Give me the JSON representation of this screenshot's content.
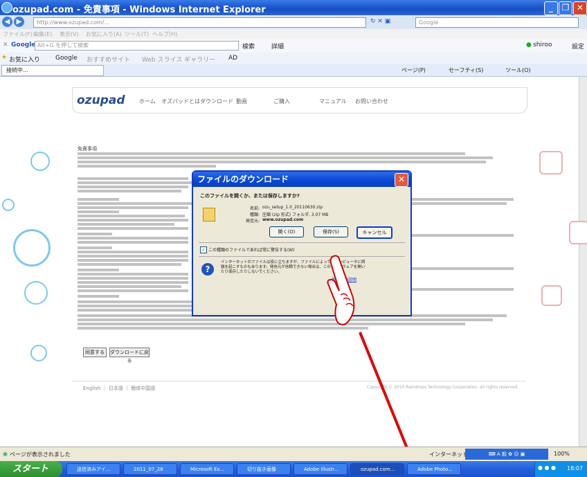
{
  "window": {
    "title": "ozupad.com - 免責事項 - Windows Internet Explorer"
  },
  "addressbar": {
    "url": "http://www.ozupad.com/...",
    "search_placeholder": "Google"
  },
  "menubar": {
    "items": [
      "ファイル(F)",
      "編集(E)",
      "表示(V)",
      "お気に入り(A)",
      "ツール(T)",
      "ヘルプ(H)"
    ]
  },
  "google_toolbar": {
    "label": "Google",
    "search_hint": "Alt+G を押して検索",
    "search_btn": "検索",
    "more": "詳細",
    "user": "shiroo",
    "settings": "設定"
  },
  "favorites": {
    "fav_label": "お気に入り",
    "item1": "Google",
    "item2": "おすすめサイト",
    "item3": "Web スライス ギャラリー",
    "item4": "AD"
  },
  "tab": {
    "label": "接続中..."
  },
  "commandbar": {
    "page": "ページ(P)",
    "safety": "セーフティ(S)",
    "tools": "ツール(O)"
  },
  "site": {
    "logo": "ozupad",
    "nav": [
      "ホーム",
      "オズパッドとは",
      "ダウンロード",
      "動画",
      "ご購入",
      "マニュアル",
      "お問い合わせ"
    ],
    "disclaimer_title": "免責事項",
    "btn_agree": "同意する",
    "btn_back": "ダウンロードに戻る",
    "footer_links": "English ｜ 日本語 ｜ 簡体中国語",
    "copyright": "Copyright © 2010 Raindrops Technology Corporation. all rights reserved."
  },
  "dialog": {
    "title": "ファイルのダウンロード",
    "question": "このファイルを開くか、または保存しますか?",
    "name_label": "名前:",
    "name_value": "ozu_setup_1.0_20110630.zip",
    "type_label": "種類:",
    "type_value": "圧縮 (zip 形式) フォルダ, 3.07 MB",
    "from_label": "発信元:",
    "from_value": "www.ozupad.com",
    "open_btn": "開く(O)",
    "save_btn": "保存(S)",
    "cancel_btn": "キャンセル",
    "checkbox_label": "この種類のファイルであれば常に警告する(W)",
    "warning_text": "インターネットのファイルは役に立ちますが、ファイルによってはコンピュータに問題を起こすものもあります。発信元が信頼できない場合は、このソフトウェアを開いたり保存したりしないでください。",
    "risk_link": "危険性の説明"
  },
  "statusbar": {
    "text": "ページが表示されました",
    "zone": "インターネット",
    "zoom": "100%"
  },
  "taskbar": {
    "start": "スタート",
    "tasks": [
      "送信済みアイ...",
      "2011_07_28",
      "Microsoft Ex...",
      "切り抜き画像",
      "Adobe Illustr...",
      "ozupad.com...",
      "Adobe Photo..."
    ],
    "clock": "18:07"
  }
}
